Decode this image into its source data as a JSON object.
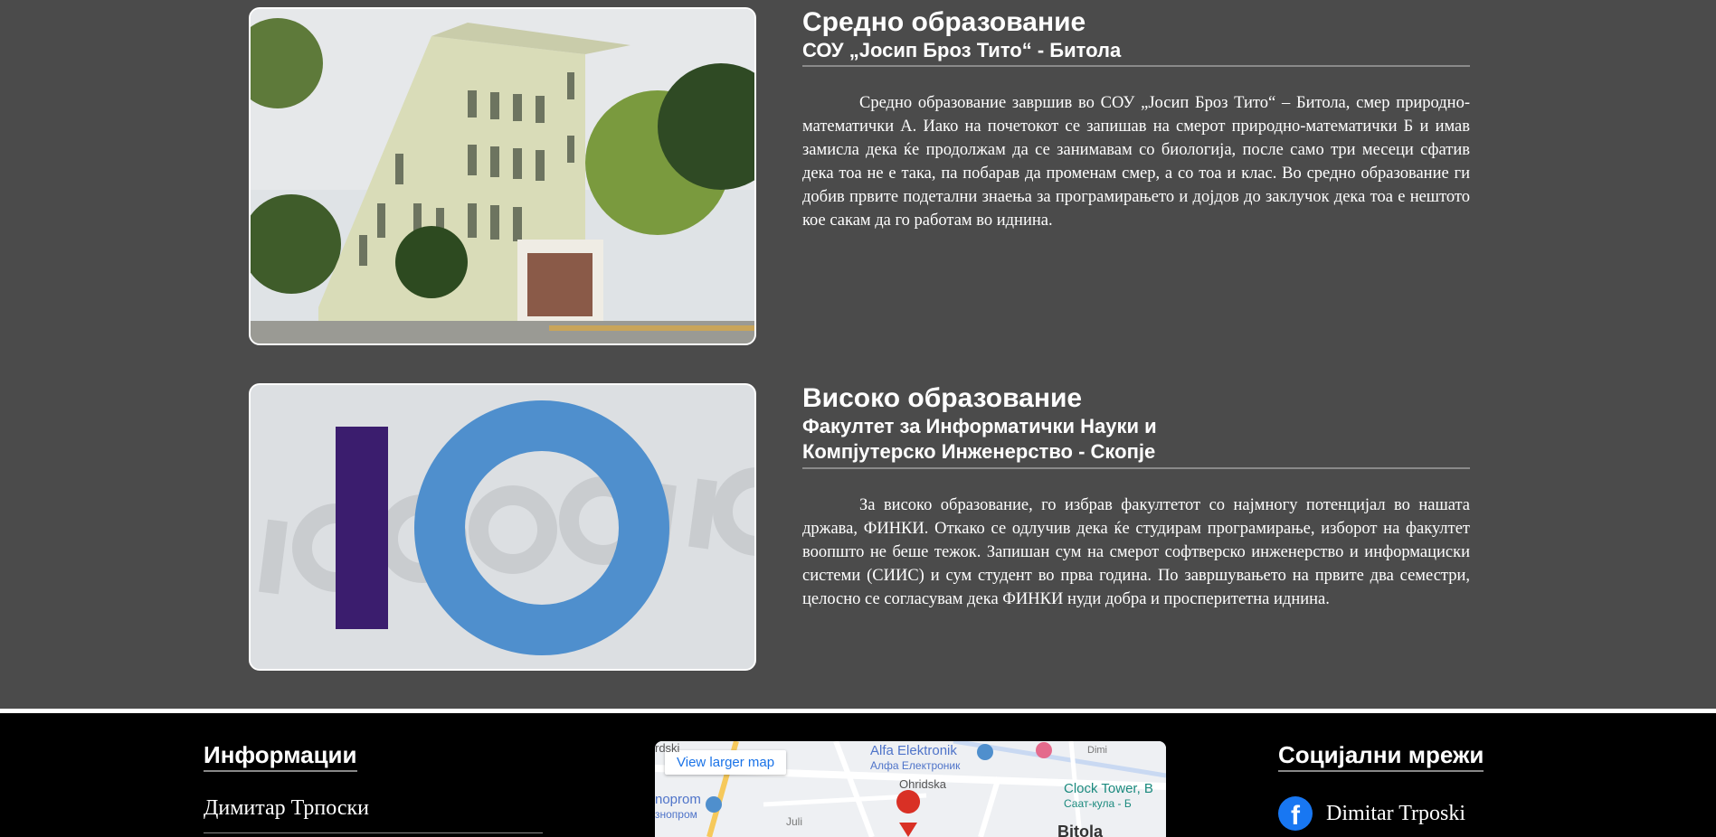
{
  "secondary": {
    "title": "Средно образование",
    "subtitle": "СОУ „Јосип Броз Тито“ - Битола",
    "paragraph": "Средно образование завршив во СОУ „Јосип Броз Тито“ – Битола, смер природно-математички А. Иако на почетокот се запишав на смерот природно-математички Б и имав замисла дека ќе продолжам да се занимавам со биологија, после само три месеци сфатив дека тоа не е така, па побарав да променам смер, а со тоа и клас. Во средно образование ги добив првите подетални знаења за програмирањето и дојдов до заклучок дека тоа е нештото кое сакам да го работам во иднина."
  },
  "higher": {
    "title": "Високо образование",
    "subtitle_line1": "Факултет за Информатички Науки и",
    "subtitle_line2": "Компјутерско Инженерство - Скопје",
    "paragraph": "За високо образование, го избрав факултетот со најмногу потенцијал во нашата држава, ФИНКИ. Откако се одлучив дека ќе студирам програмирање, изборот на факултет воопшто не беше тежок. Запишан сум на смерот софтверско инженерство и информациски системи (СИИС) и сум студент во прва година. По завршувањето на првите два семестри, целосно се согласувам дека ФИНКИ нуди добра и просперитетна иднина."
  },
  "footer": {
    "info_title": "Информации",
    "name": "Димитар Трпоски",
    "social_title": "Социјални мрежи",
    "facebook_name": "Dimitar Trposki",
    "map": {
      "button": "View larger map",
      "labels": {
        "skopje": "Alfa Elektronik",
        "skopje_cyr": "Алфа Електроник",
        "tower": "Clock Tower, B",
        "tower_cyr": "Саат-кула - Б",
        "street": "Ohridska",
        "shop": "nоprom",
        "shop_cyr": "знопром",
        "city": "Bitola",
        "left_top": "rdski",
        "juli": "Juli",
        "dim": "Dimi"
      }
    }
  },
  "colors": {
    "background": "#4b4b4b",
    "footer": "#000000",
    "fink_purple": "#3b1d6e",
    "fink_blue": "#4f8fcd",
    "facebook": "#1877f2"
  }
}
